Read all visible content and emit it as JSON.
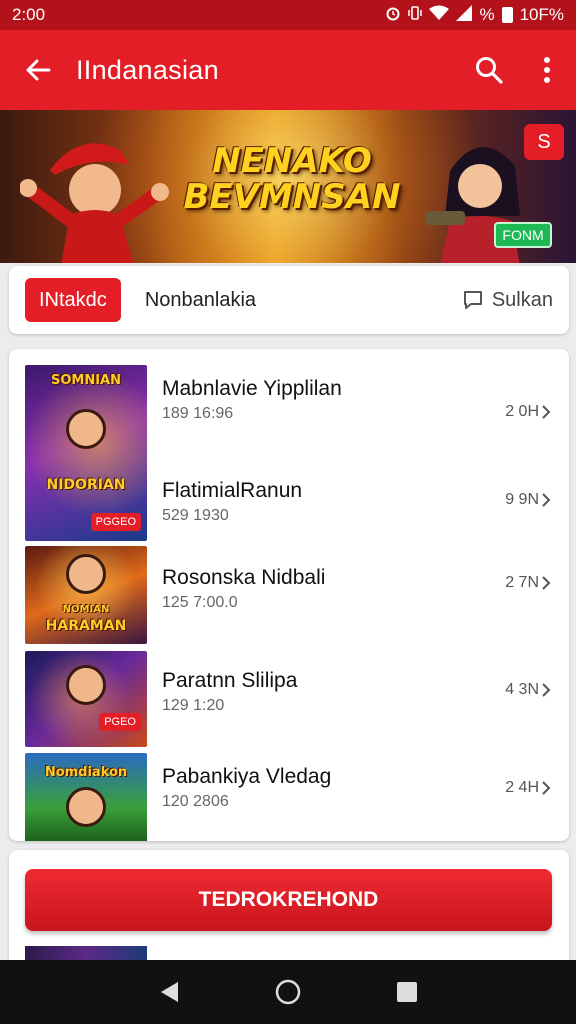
{
  "status_bar": {
    "time": "2:00",
    "indicators": [
      "alarm-icon",
      "vibrate-icon",
      "wifi-icon",
      "signal-icon",
      "battery-icon"
    ],
    "percent_symbol": "%",
    "battery": "10F%"
  },
  "app_bar": {
    "title": "IIndanasian",
    "back_icon": "arrow-left-icon",
    "search_icon": "search-icon",
    "more_icon": "more-vert-icon"
  },
  "banner": {
    "headline_line1": "NENAKO",
    "headline_line2": "BEVMNSAN",
    "badge": "FONM",
    "corner_logo": "S"
  },
  "filter": {
    "pill": "INtakdc",
    "label": "Nonbanlakia",
    "sort_label": "Sulkan"
  },
  "games": [
    {
      "thumb_title": "SOMNIAN",
      "thumb_subtitle": "NIDORIAN",
      "thumb_tag": "PGGEO",
      "name": "Mabnlavie Yipplilan",
      "meta": "189 16:96",
      "size": "2 0H"
    },
    {
      "name": "FlatimialRanun",
      "meta": "529 1930",
      "size": "9 9N"
    },
    {
      "thumb_title": "NOMIAN",
      "thumb_subtitle": "HARAMAN",
      "name": "Rosonska Nidbali",
      "meta": "125 7:00.0",
      "size": "2 7N"
    },
    {
      "thumb_tag": "PGEO",
      "name": "Paratnn Slilipa",
      "meta": "129 1:20",
      "size": "4 3N"
    },
    {
      "thumb_title": "Nomdiakon",
      "name": "Pabankiya Vledag",
      "meta": "120 2806",
      "size": "2 4H"
    }
  ],
  "cta": {
    "label": "TEDROKREHOND"
  },
  "nav_bar": {
    "back": "triangle-back-icon",
    "home": "circle-home-icon",
    "recents": "square-recents-icon"
  },
  "colors": {
    "primary": "#e41e26",
    "status": "#b3121a",
    "badge_green": "#1db954"
  }
}
